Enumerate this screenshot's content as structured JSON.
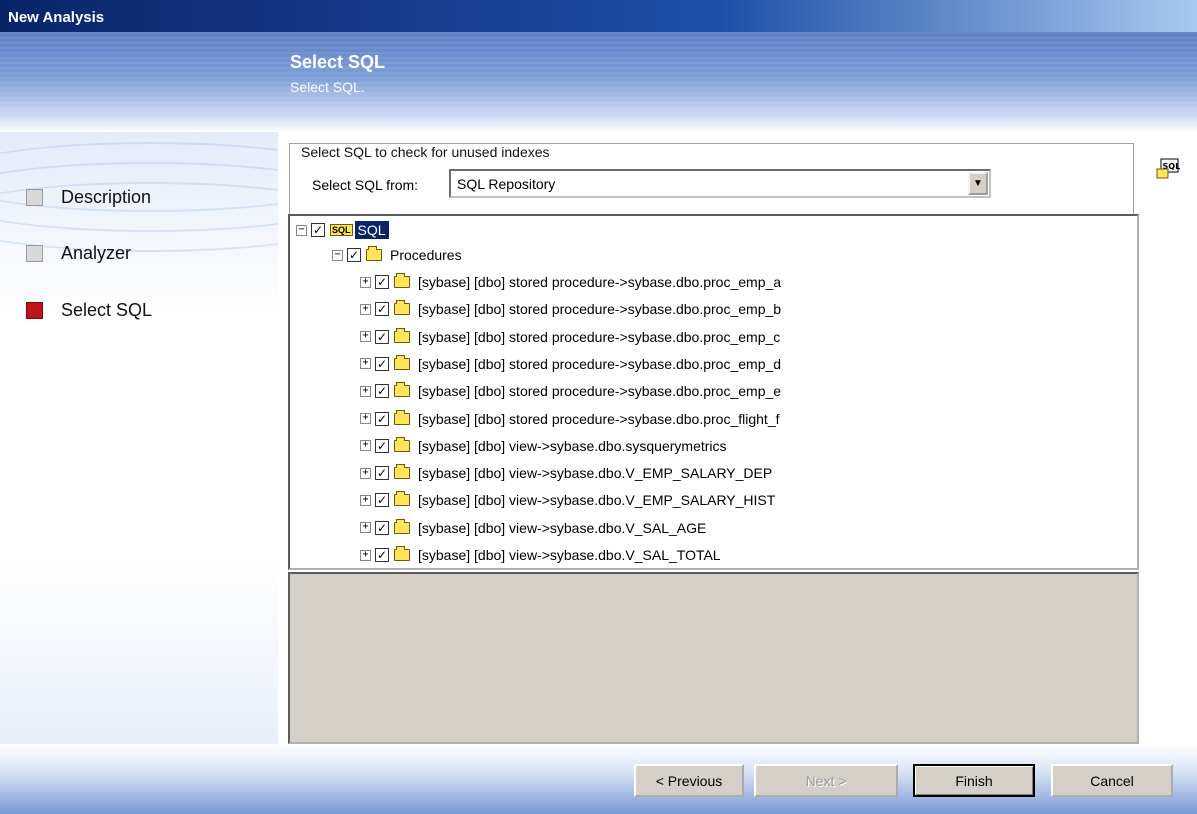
{
  "window": {
    "title": "New Analysis"
  },
  "banner": {
    "title": "Select SQL",
    "subtitle": "Select SQL."
  },
  "steps": [
    {
      "label": "Description",
      "active": false
    },
    {
      "label": "Analyzer",
      "active": false
    },
    {
      "label": "Select SQL",
      "active": true
    }
  ],
  "group": {
    "legend": "Select SQL to check for unused indexes",
    "select_label": "Select SQL from:",
    "select_value": "SQL Repository"
  },
  "sql_button": {
    "icon": "sql-icon",
    "label": "SQL"
  },
  "tree": {
    "root": {
      "label": "SQL",
      "checked": true,
      "icon": "sql-folder-icon"
    },
    "procedures": {
      "label": "Procedures",
      "checked": true
    },
    "items": [
      "[sybase] [dbo] stored procedure->sybase.dbo.proc_emp_a",
      "[sybase] [dbo] stored procedure->sybase.dbo.proc_emp_b",
      "[sybase] [dbo] stored procedure->sybase.dbo.proc_emp_c",
      "[sybase] [dbo] stored procedure->sybase.dbo.proc_emp_d",
      "[sybase] [dbo] stored procedure->sybase.dbo.proc_emp_e",
      "[sybase] [dbo] stored procedure->sybase.dbo.proc_flight_f",
      "[sybase] [dbo] view->sybase.dbo.sysquerymetrics",
      "[sybase] [dbo] view->sybase.dbo.V_EMP_SALARY_DEP",
      "[sybase] [dbo] view->sybase.dbo.V_EMP_SALARY_HIST",
      "[sybase] [dbo] view->sybase.dbo.V_SAL_AGE",
      "[sybase] [dbo] view->sybase.dbo.V_SAL_TOTAL"
    ]
  },
  "buttons": {
    "previous": "< Previous",
    "next": "Next >",
    "finish": "Finish",
    "cancel": "Cancel"
  },
  "colors": {
    "active_step": "#c0141a",
    "selection": "#0a246a",
    "folder": "#ffe45c"
  }
}
